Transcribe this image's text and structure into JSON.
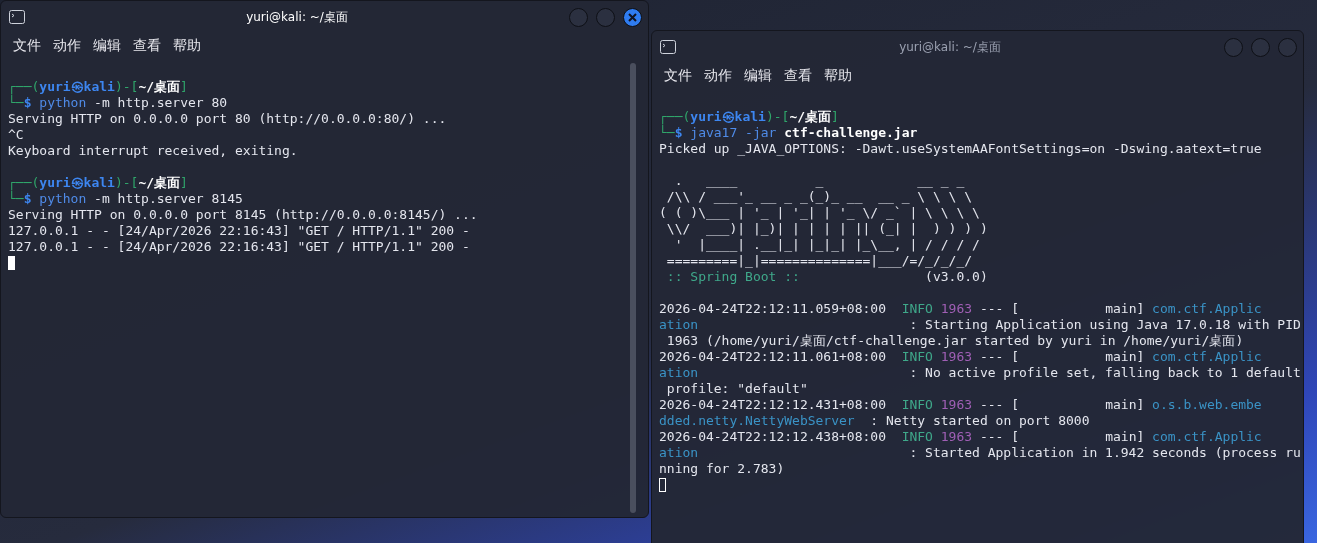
{
  "windows": [
    {
      "title": "yuri@kali: ~/桌面",
      "active": true,
      "menu": [
        "文件",
        "动作",
        "编辑",
        "查看",
        "帮助"
      ],
      "lines": [
        {
          "kind": "blank"
        },
        {
          "kind": "text",
          "segments": [
            {
              "text": "┌──(",
              "kind": "frame"
            },
            {
              "text": "yuri㉿kali",
              "kind": "user"
            },
            {
              "text": ")-[",
              "kind": "frame"
            },
            {
              "text": "~/桌面",
              "kind": "path"
            },
            {
              "text": "]",
              "kind": "frame"
            }
          ]
        },
        {
          "kind": "text",
          "segments": [
            {
              "text": "└─",
              "kind": "frame"
            },
            {
              "text": "$",
              "kind": "user"
            },
            {
              "text": " python",
              "kind": "cmd"
            },
            {
              "text": " -m http.server 80",
              "kind": "plain"
            }
          ]
        },
        {
          "kind": "text",
          "segments": [
            {
              "text": "Serving HTTP on 0.0.0.0 port 80 (http://0.0.0.0:80/) ...",
              "kind": "plain"
            }
          ]
        },
        {
          "kind": "text",
          "segments": [
            {
              "text": "^C",
              "kind": "plain"
            }
          ]
        },
        {
          "kind": "text",
          "segments": [
            {
              "text": "Keyboard interrupt received, exiting.",
              "kind": "plain"
            }
          ]
        },
        {
          "kind": "blank"
        },
        {
          "kind": "text",
          "segments": [
            {
              "text": "┌──(",
              "kind": "frame"
            },
            {
              "text": "yuri㉿kali",
              "kind": "user"
            },
            {
              "text": ")-[",
              "kind": "frame"
            },
            {
              "text": "~/桌面",
              "kind": "path"
            },
            {
              "text": "]",
              "kind": "frame"
            }
          ]
        },
        {
          "kind": "text",
          "segments": [
            {
              "text": "└─",
              "kind": "frame"
            },
            {
              "text": "$",
              "kind": "user"
            },
            {
              "text": " python",
              "kind": "cmd"
            },
            {
              "text": " -m http.server 8145",
              "kind": "plain"
            }
          ]
        },
        {
          "kind": "text",
          "segments": [
            {
              "text": "Serving HTTP on 0.0.0.0 port 8145 (http://0.0.0.0:8145/) ...",
              "kind": "plain"
            }
          ]
        },
        {
          "kind": "text",
          "segments": [
            {
              "text": "127.0.0.1 - - [24/Apr/2026 22:16:43] \"GET / HTTP/1.1\" 200 -",
              "kind": "plain"
            }
          ]
        },
        {
          "kind": "text",
          "segments": [
            {
              "text": "127.0.0.1 - - [24/Apr/2026 22:16:43] \"GET / HTTP/1.1\" 200 -",
              "kind": "plain"
            }
          ]
        }
      ]
    },
    {
      "title": "yuri@kali: ~/桌面",
      "active": false,
      "menu": [
        "文件",
        "动作",
        "编辑",
        "查看",
        "帮助"
      ],
      "lines": [
        {
          "kind": "blank"
        },
        {
          "kind": "text",
          "segments": [
            {
              "text": "┌──(",
              "kind": "frame"
            },
            {
              "text": "yuri㉿kali",
              "kind": "user"
            },
            {
              "text": ")-[",
              "kind": "frame"
            },
            {
              "text": "~/桌面",
              "kind": "path"
            },
            {
              "text": "]",
              "kind": "frame"
            }
          ]
        },
        {
          "kind": "text",
          "segments": [
            {
              "text": "└─",
              "kind": "frame"
            },
            {
              "text": "$",
              "kind": "user"
            },
            {
              "text": " java17 -jar ",
              "kind": "cmd"
            },
            {
              "text": "ctf-challenge.jar",
              "kind": "path"
            }
          ]
        },
        {
          "kind": "text",
          "segments": [
            {
              "text": "Picked up _JAVA_OPTIONS: -Dawt.useSystemAAFontSettings=on -Dswing.aatext=true",
              "kind": "plain"
            }
          ]
        },
        {
          "kind": "blank"
        },
        {
          "kind": "text",
          "segments": [
            {
              "text": "  .   ____          _            __ _ _",
              "kind": "plain"
            }
          ]
        },
        {
          "kind": "text",
          "segments": [
            {
              "text": " /\\\\ / ___'_ __ _ _(_)_ __  __ _ \\ \\ \\ \\",
              "kind": "plain"
            }
          ]
        },
        {
          "kind": "text",
          "segments": [
            {
              "text": "( ( )\\___ | '_ | '_| | '_ \\/ _` | \\ \\ \\ \\",
              "kind": "plain"
            }
          ]
        },
        {
          "kind": "text",
          "segments": [
            {
              "text": " \\\\/  ___)| |_)| | | | | || (_| |  ) ) ) )",
              "kind": "plain"
            }
          ]
        },
        {
          "kind": "text",
          "segments": [
            {
              "text": "  '  |____| .__|_| |_|_| |_\\__, | / / / /",
              "kind": "plain"
            }
          ]
        },
        {
          "kind": "text",
          "segments": [
            {
              "text": " =========|_|==============|___/=/_/_/_/",
              "kind": "plain"
            }
          ]
        },
        {
          "kind": "text",
          "segments": [
            {
              "text": " :: Spring Boot :: ",
              "kind": "spring"
            },
            {
              "text": "               (v3.0.0)",
              "kind": "plain"
            }
          ]
        },
        {
          "kind": "blank"
        },
        {
          "kind": "text",
          "segments": [
            {
              "text": "2026-04-24T22:12:11.059+08:00  ",
              "kind": "plain"
            },
            {
              "text": "INFO",
              "kind": "info"
            },
            {
              "text": " 1963",
              "kind": "pid"
            },
            {
              "text": " --- [           main] ",
              "kind": "plain"
            },
            {
              "text": "com.ctf.Applic",
              "kind": "logger"
            }
          ]
        },
        {
          "kind": "text",
          "segments": [
            {
              "text": "ation                           ",
              "kind": "logger"
            },
            {
              "text": ": Starting Application using Java 17.0.18 with PID",
              "kind": "plain"
            }
          ]
        },
        {
          "kind": "text",
          "segments": [
            {
              "text": " 1963 (/home/yuri/桌面/ctf-challenge.jar started by yuri in /home/yuri/桌面)",
              "kind": "plain"
            }
          ]
        },
        {
          "kind": "text",
          "segments": [
            {
              "text": "2026-04-24T22:12:11.061+08:00  ",
              "kind": "plain"
            },
            {
              "text": "INFO",
              "kind": "info"
            },
            {
              "text": " 1963",
              "kind": "pid"
            },
            {
              "text": " --- [           main] ",
              "kind": "plain"
            },
            {
              "text": "com.ctf.Applic",
              "kind": "logger"
            }
          ]
        },
        {
          "kind": "text",
          "segments": [
            {
              "text": "ation                           ",
              "kind": "logger"
            },
            {
              "text": ": No active profile set, falling back to 1 default",
              "kind": "plain"
            }
          ]
        },
        {
          "kind": "text",
          "segments": [
            {
              "text": " profile: \"default\"",
              "kind": "plain"
            }
          ]
        },
        {
          "kind": "text",
          "segments": [
            {
              "text": "2026-04-24T22:12:12.431+08:00  ",
              "kind": "plain"
            },
            {
              "text": "INFO",
              "kind": "info"
            },
            {
              "text": " 1963",
              "kind": "pid"
            },
            {
              "text": " --- [           main] ",
              "kind": "plain"
            },
            {
              "text": "o.s.b.web.embe",
              "kind": "logger"
            }
          ]
        },
        {
          "kind": "text",
          "segments": [
            {
              "text": "dded.netty.NettyWebServer  ",
              "kind": "logger"
            },
            {
              "text": ": Netty started on port 8000",
              "kind": "plain"
            }
          ]
        },
        {
          "kind": "text",
          "segments": [
            {
              "text": "2026-04-24T22:12:12.438+08:00  ",
              "kind": "plain"
            },
            {
              "text": "INFO",
              "kind": "info"
            },
            {
              "text": " 1963",
              "kind": "pid"
            },
            {
              "text": " --- [           main] ",
              "kind": "plain"
            },
            {
              "text": "com.ctf.Applic",
              "kind": "logger"
            }
          ]
        },
        {
          "kind": "text",
          "segments": [
            {
              "text": "ation                           ",
              "kind": "logger"
            },
            {
              "text": ": Started Application in 1.942 seconds (process ru",
              "kind": "plain"
            }
          ]
        },
        {
          "kind": "text",
          "segments": [
            {
              "text": "nning for 2.783)",
              "kind": "plain"
            }
          ]
        }
      ]
    }
  ]
}
